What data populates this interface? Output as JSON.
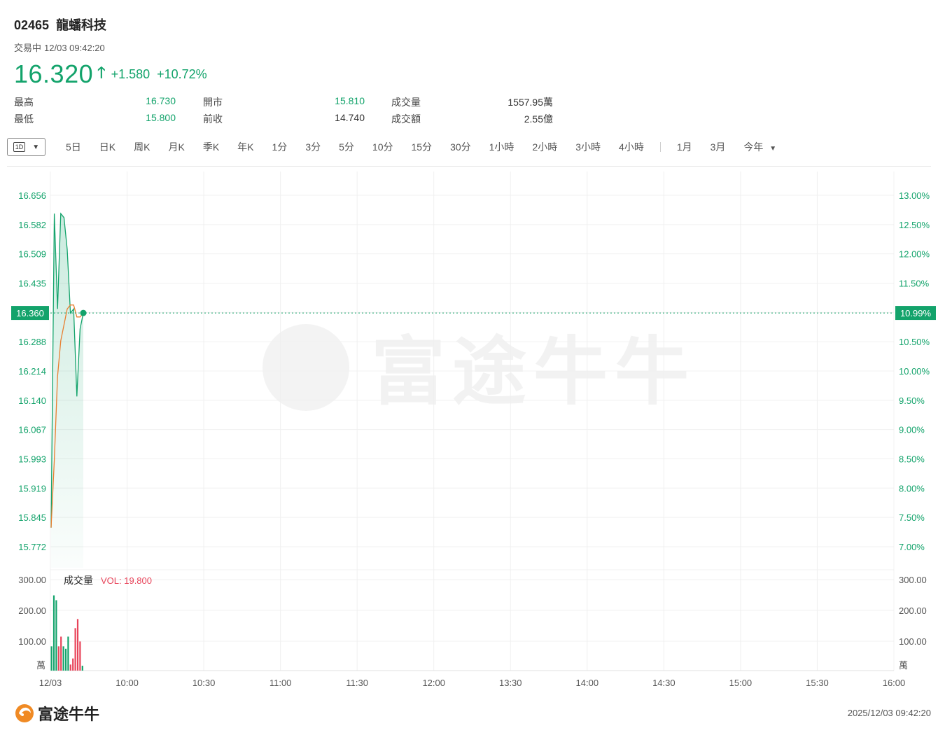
{
  "header": {
    "code": "02465",
    "name": "龍蟠科技",
    "status": "交易中",
    "time": "12/03 09:42:20",
    "price": "16.320",
    "change": "+1.580",
    "change_pct": "+10.72%"
  },
  "stats": {
    "high_label": "最高",
    "high": "16.730",
    "low_label": "最低",
    "low": "15.800",
    "open_label": "開市",
    "open": "15.810",
    "prev_label": "前收",
    "prev": "14.740",
    "vol_label": "成交量",
    "vol": "1557.95萬",
    "amt_label": "成交額",
    "amt": "2.55億"
  },
  "tabs": {
    "selected": "1D",
    "items": [
      "5日",
      "日K",
      "周K",
      "月K",
      "季K",
      "年K",
      "1分",
      "3分",
      "5分",
      "10分",
      "15分",
      "30分",
      "1小時",
      "2小時",
      "3小時",
      "4小時"
    ],
    "extra": [
      "1月",
      "3月",
      "今年"
    ]
  },
  "chart_data": {
    "type": "line",
    "y_ticks": [
      "16.656",
      "16.582",
      "16.509",
      "16.435",
      "16.360",
      "16.288",
      "16.214",
      "16.140",
      "16.067",
      "15.993",
      "15.919",
      "15.845",
      "15.772"
    ],
    "pct_ticks": [
      "13.00%",
      "12.50%",
      "12.00%",
      "11.50%",
      "10.99%",
      "10.50%",
      "10.00%",
      "9.50%",
      "9.00%",
      "8.50%",
      "8.00%",
      "7.50%",
      "7.00%"
    ],
    "current_price_label": "16.360",
    "current_pct_label": "10.99%",
    "current_price": 16.36,
    "ylim": [
      15.772,
      16.656
    ],
    "x_ticks": [
      "12/03",
      "10:00",
      "10:30",
      "11:00",
      "11:30",
      "12:00",
      "13:30",
      "14:00",
      "14:30",
      "15:00",
      "15:30",
      "16:00"
    ],
    "price_series": {
      "color": "#13a36b",
      "values": [
        15.82,
        16.61,
        16.37,
        16.61,
        16.6,
        16.52,
        16.36,
        16.37,
        16.15,
        16.32,
        16.36
      ]
    },
    "avg_series": {
      "color": "#e87e2f",
      "values": [
        15.82,
        15.99,
        16.2,
        16.29,
        16.33,
        16.37,
        16.38,
        16.38,
        16.35,
        16.35,
        16.36
      ]
    },
    "volume": {
      "title": "成交量",
      "vol_label": "VOL: 19.800",
      "unit": "萬",
      "y_ticks": [
        "300.00",
        "200.00",
        "100.00"
      ],
      "ylim": [
        0,
        300
      ],
      "bars": [
        {
          "v": 80,
          "c": "#13a36b"
        },
        {
          "v": 248,
          "c": "#13a36b"
        },
        {
          "v": 232,
          "c": "#13a36b"
        },
        {
          "v": 80,
          "c": "#e8445a"
        },
        {
          "v": 112,
          "c": "#e8445a"
        },
        {
          "v": 80,
          "c": "#13a36b"
        },
        {
          "v": 72,
          "c": "#13a36b"
        },
        {
          "v": 112,
          "c": "#13a36b"
        },
        {
          "v": 20,
          "c": "#e8445a"
        },
        {
          "v": 40,
          "c": "#e8445a"
        },
        {
          "v": 140,
          "c": "#e8445a"
        },
        {
          "v": 170,
          "c": "#e8445a"
        },
        {
          "v": 96,
          "c": "#e8445a"
        },
        {
          "v": 16,
          "c": "#13a36b"
        }
      ]
    }
  },
  "footer": {
    "brand": "富途牛牛",
    "timestamp": "2025/12/03 09:42:20"
  },
  "watermark": "富途牛牛",
  "colors": {
    "up": "#13a36b",
    "down": "#e8445a",
    "avg": "#e87e2f"
  }
}
